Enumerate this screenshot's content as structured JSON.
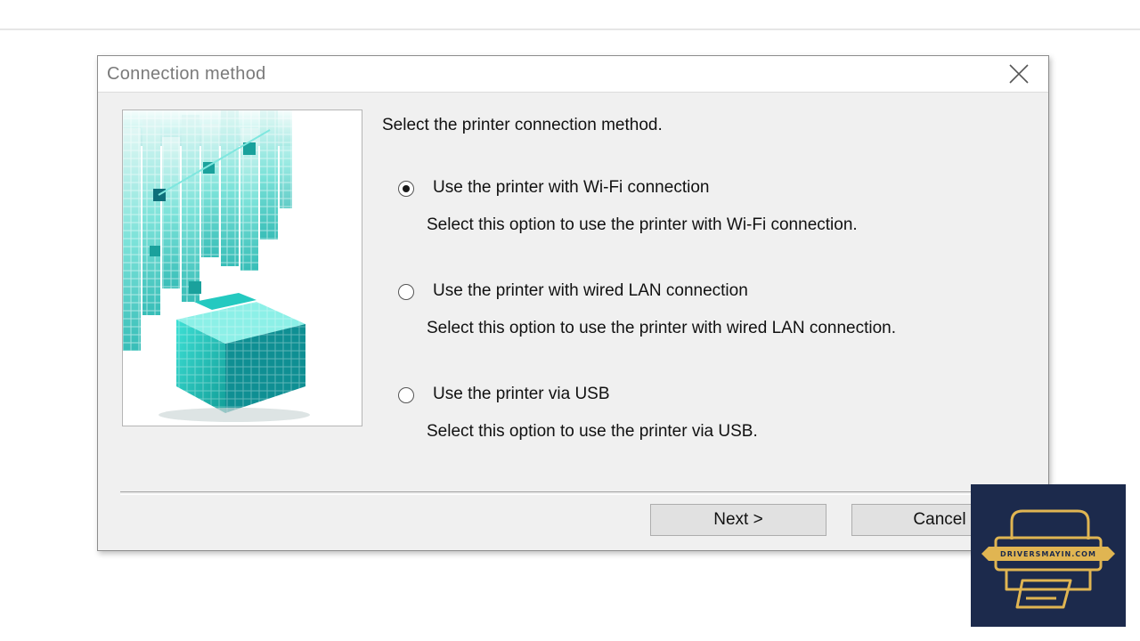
{
  "dialog": {
    "title": "Connection method",
    "prompt": "Select the printer connection method.",
    "options": [
      {
        "label": "Use the printer with Wi-Fi connection",
        "description": "Select this option to use the printer with Wi-Fi connection.",
        "selected": true
      },
      {
        "label": "Use the printer with wired LAN connection",
        "description": "Select this option to use the printer with wired LAN connection.",
        "selected": false
      },
      {
        "label": "Use the printer via USB",
        "description": "Select this option to use the printer via USB.",
        "selected": false
      }
    ],
    "buttons": {
      "next": "Next >",
      "cancel": "Cancel"
    }
  },
  "watermark": {
    "text": "DRIVERSMAYIN.COM"
  },
  "colors": {
    "accent": "#2fd3c8",
    "logo_bg": "#1c2a4c",
    "logo_gold": "#e0b552"
  },
  "icons": {
    "close": "close-icon",
    "logo": "printer-logo-icon"
  }
}
